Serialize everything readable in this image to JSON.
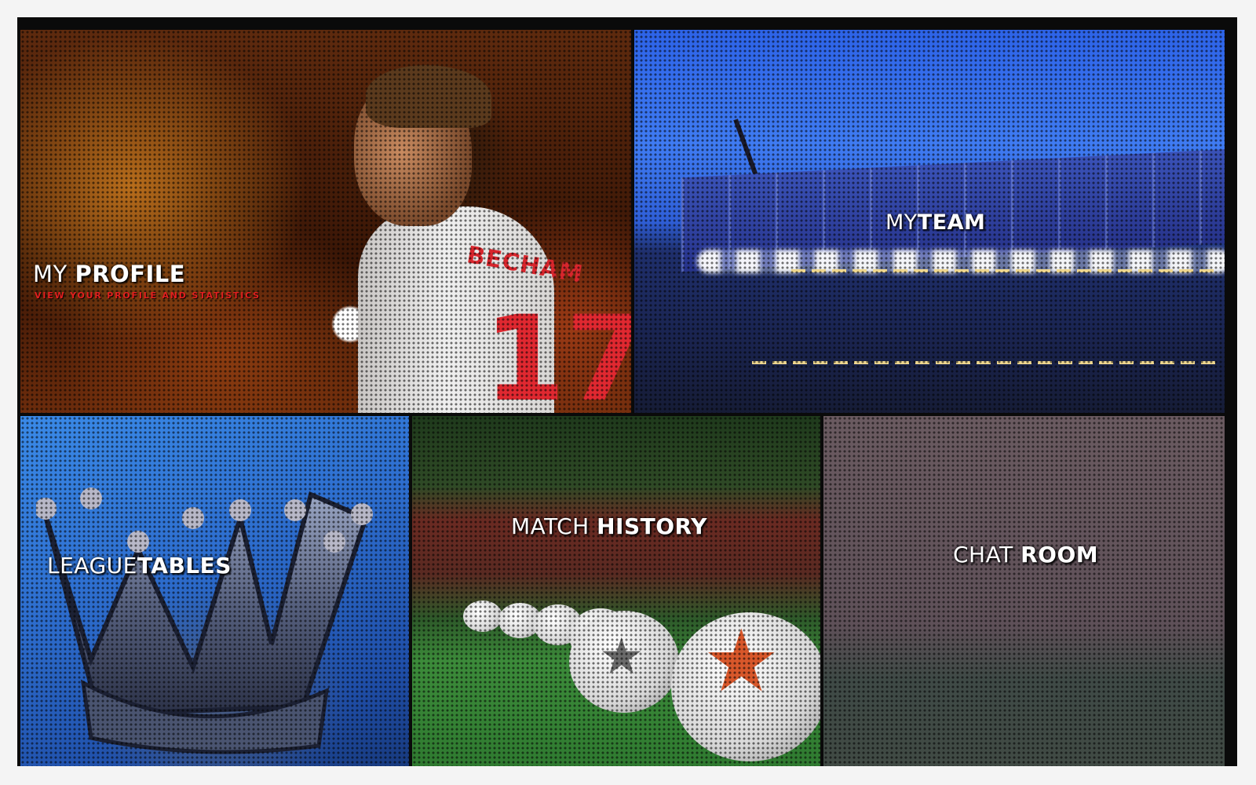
{
  "tiles": {
    "profile": {
      "title_light": "MY",
      "title_bold": "PROFILE",
      "subtitle": "VIEW YOUR PROFILE AND STATISTICS",
      "jersey_name": "BECHAM",
      "jersey_number": "17"
    },
    "team": {
      "title_light": "MY",
      "title_bold": "TEAM"
    },
    "league": {
      "title_light": "LEAGUE",
      "title_bold": "TABLES"
    },
    "match": {
      "title_light": "MATCH",
      "title_bold": "HISTORY"
    },
    "chat": {
      "title_light": "CHAT",
      "title_bold": "ROOM"
    }
  },
  "colors": {
    "frame": "#0a0a0a",
    "subtitle_red": "#e11f1f",
    "label_white": "#ffffff"
  }
}
